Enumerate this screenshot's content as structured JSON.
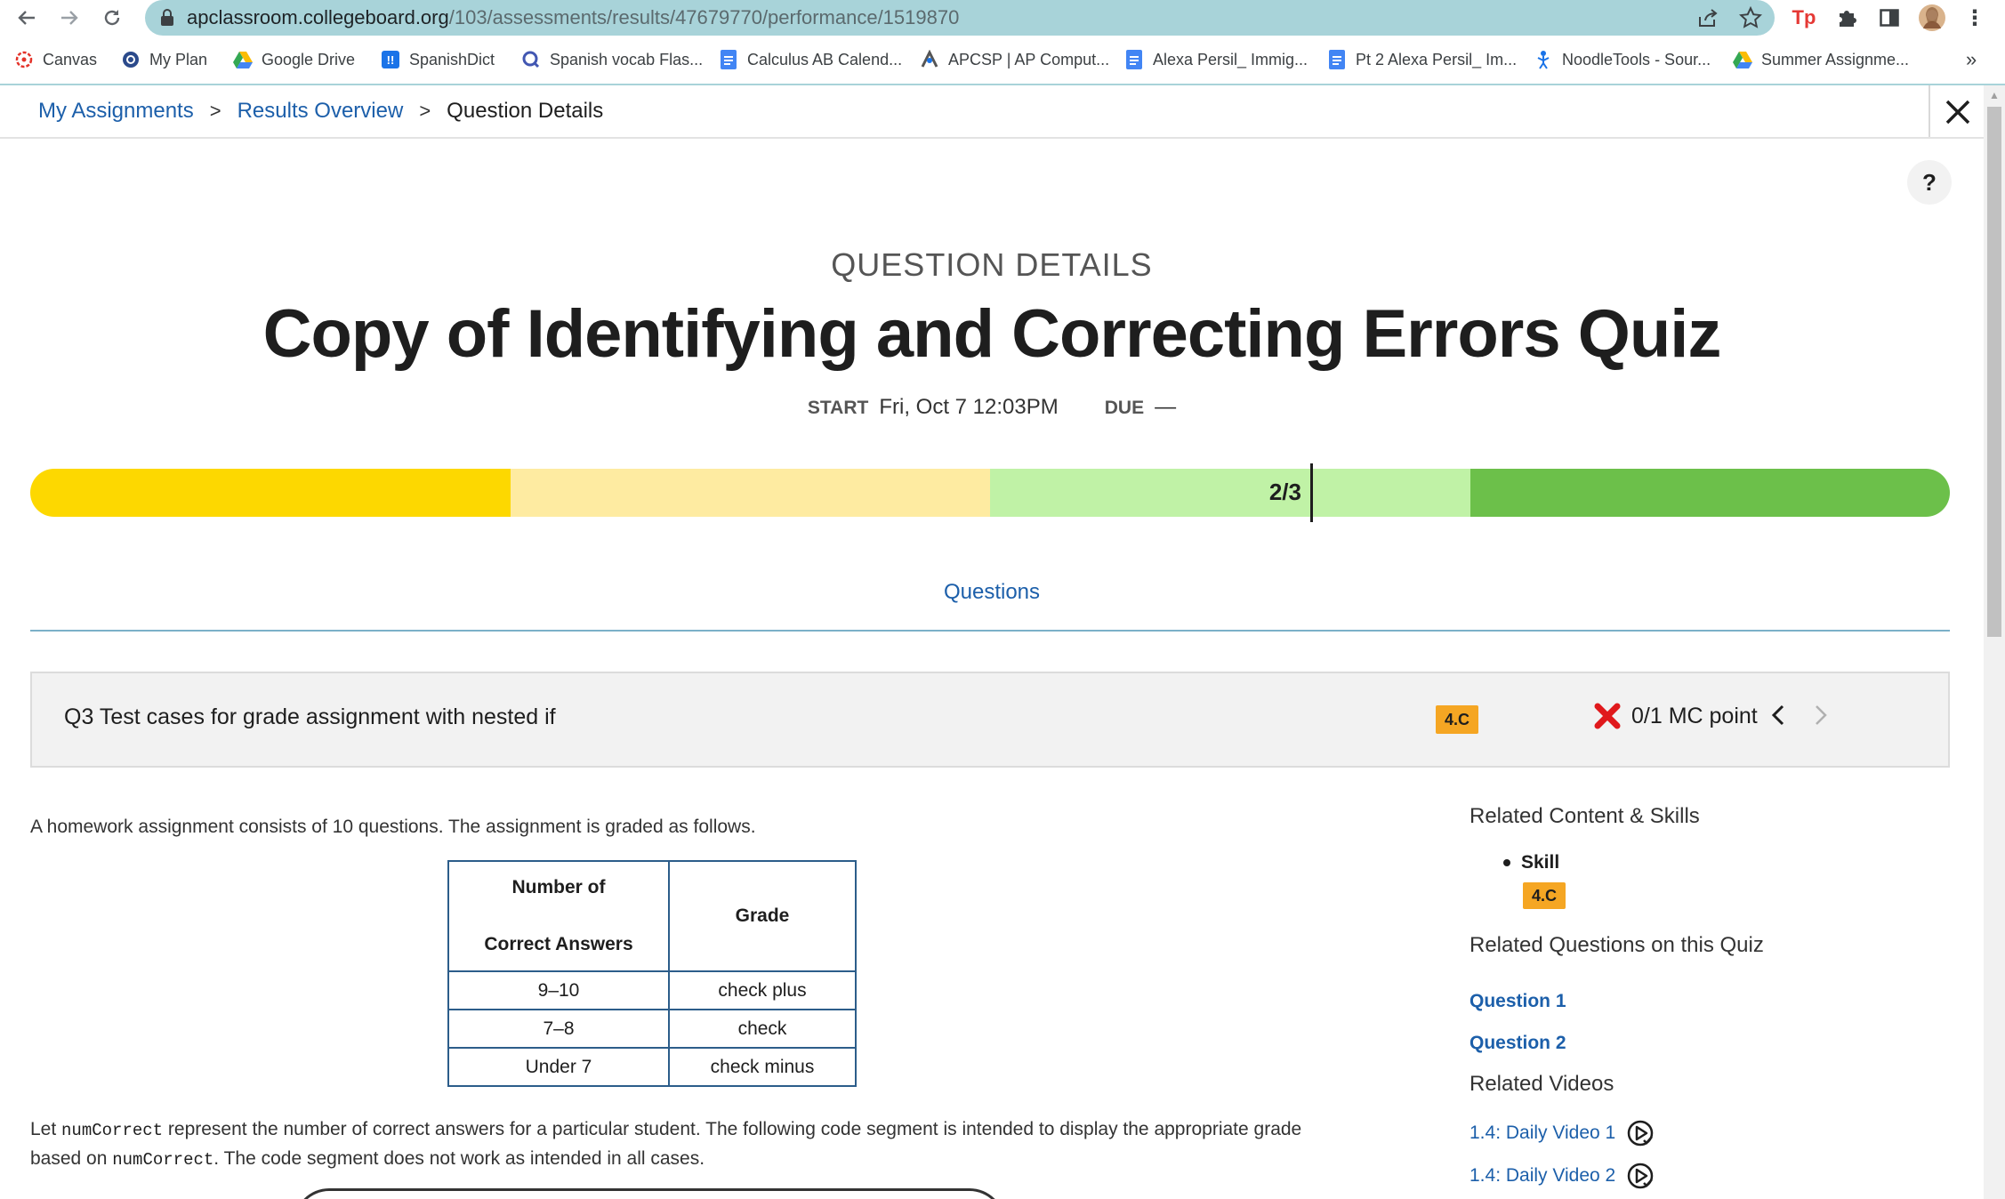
{
  "browser": {
    "url_host": "apclassroom.collegeboard.org",
    "url_path": "/103/assessments/results/47679770/performance/1519870",
    "bookmarks": [
      {
        "label": "Canvas",
        "icon": "canvas-icon"
      },
      {
        "label": "My Plan",
        "icon": "plan-icon"
      },
      {
        "label": "Google Drive",
        "icon": "google-drive-icon"
      },
      {
        "label": "SpanishDict",
        "icon": "spanishdict-icon"
      },
      {
        "label": "Spanish vocab Flas...",
        "icon": "quizlet-icon"
      },
      {
        "label": "Calculus AB Calend...",
        "icon": "google-docs-icon"
      },
      {
        "label": "APCSP | AP Comput...",
        "icon": "apcsp-icon"
      },
      {
        "label": "Alexa Persil_ Immig...",
        "icon": "google-docs-icon"
      },
      {
        "label": "Pt 2 Alexa Persil_ Im...",
        "icon": "google-docs-icon"
      },
      {
        "label": "NoodleTools - Sour...",
        "icon": "noodletools-icon"
      },
      {
        "label": "Summer Assignme...",
        "icon": "google-drive-icon"
      }
    ],
    "more_bookmarks": "»"
  },
  "breadcrumb": {
    "items": [
      "My Assignments",
      "Results Overview"
    ],
    "current": "Question Details",
    "separator": ">"
  },
  "help_label": "?",
  "header": {
    "kicker": "QUESTION DETAILS",
    "title": "Copy of Identifying and Correcting Errors Quiz",
    "start_label": "START",
    "start_value": "Fri, Oct 7 12:03PM",
    "due_label": "DUE",
    "due_value": "—"
  },
  "progress": {
    "score_label": "2/3",
    "score_fraction": 0.6667,
    "segment_colors": [
      "#fdd800",
      "#feeba1",
      "#c0f2a6",
      "#6cc04a"
    ]
  },
  "tabs": {
    "questions_label": "Questions"
  },
  "question": {
    "title": "Q3 Test cases for grade assignment with nested if",
    "skill_badge": "4.C",
    "result_icon": "x-icon",
    "score": "0/1 MC point",
    "prev_label": "‹",
    "next_label": "›"
  },
  "body": {
    "prompt": "A homework assignment consists of 10 questions. The assignment is graded as follows.",
    "table": {
      "header_col1_line1": "Number of",
      "header_col1_line2": "Correct Answers",
      "header_col2": "Grade",
      "rows": [
        {
          "range": "9–10",
          "grade": "check plus"
        },
        {
          "range": "7–8",
          "grade": "check"
        },
        {
          "range": "Under 7",
          "grade": "check minus"
        }
      ]
    },
    "para_part1": "Let ",
    "para_code1": "numCorrect",
    "para_part2": " represent the number of correct answers for a particular student. The following code segment is intended to display the appropriate grade based on ",
    "para_code2": "numCorrect",
    "para_part3": ". The code segment does not work as intended in all cases."
  },
  "sidebar": {
    "related_content_heading": "Related Content & Skills",
    "skill_label": "Skill",
    "skill_badge": "4.C",
    "related_questions_heading": "Related Questions on this Quiz",
    "related_questions": [
      "Question 1",
      "Question 2"
    ],
    "related_videos_heading": "Related Videos",
    "related_videos": [
      "1.4: Daily Video 1",
      "1.4: Daily Video 2"
    ]
  }
}
